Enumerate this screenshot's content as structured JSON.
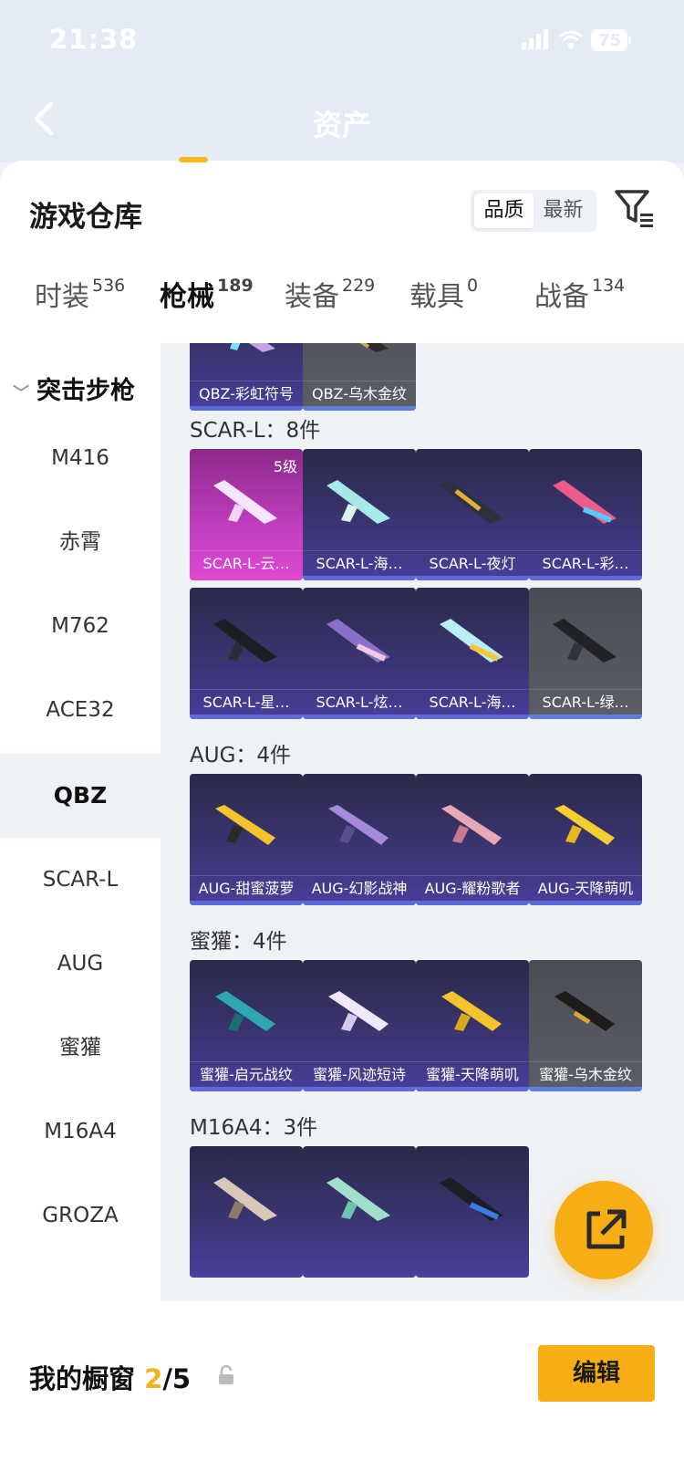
{
  "status": {
    "time": "21:38",
    "battery": "75"
  },
  "nav": {
    "title": "资产"
  },
  "sheet": {
    "title": "游戏仓库",
    "sort_options": [
      "品质",
      "最新"
    ]
  },
  "tabs": [
    {
      "label": "时装",
      "count": "536"
    },
    {
      "label": "枪械",
      "count": "189"
    },
    {
      "label": "装备",
      "count": "229"
    },
    {
      "label": "载具",
      "count": "0"
    },
    {
      "label": "战备",
      "count": "134"
    }
  ],
  "sidebar": {
    "category": "突击步枪",
    "items": [
      "M416",
      "赤霄",
      "M762",
      "ACE32",
      "QBZ",
      "SCAR-L",
      "AUG",
      "蜜獾",
      "M16A4",
      "GROZA"
    ]
  },
  "sections": [
    {
      "title": "",
      "items": [
        {
          "name": "QBZ-彩虹符号"
        },
        {
          "name": "QBZ-乌木金纹"
        }
      ]
    },
    {
      "title": "SCAR-L：8件",
      "items": [
        {
          "name": "SCAR-L-云…",
          "level": "5级"
        },
        {
          "name": "SCAR-L-海…"
        },
        {
          "name": "SCAR-L-夜灯"
        },
        {
          "name": "SCAR-L-彩…"
        },
        {
          "name": "SCAR-L-星…"
        },
        {
          "name": "SCAR-L-炫…"
        },
        {
          "name": "SCAR-L-海…"
        },
        {
          "name": "SCAR-L-绿…"
        }
      ]
    },
    {
      "title": "AUG：4件",
      "items": [
        {
          "name": "AUG-甜蜜菠萝"
        },
        {
          "name": "AUG-幻影战神"
        },
        {
          "name": "AUG-耀粉歌者"
        },
        {
          "name": "AUG-天降萌叽"
        }
      ]
    },
    {
      "title": "蜜獾：4件",
      "items": [
        {
          "name": "蜜獾-启元战纹"
        },
        {
          "name": "蜜獾-风迹短诗"
        },
        {
          "name": "蜜獾-天降萌叽"
        },
        {
          "name": "蜜獾-乌木金纹"
        }
      ]
    },
    {
      "title": "M16A4：3件",
      "items": [
        {
          "name": ""
        },
        {
          "name": ""
        },
        {
          "name": ""
        }
      ]
    }
  ],
  "bottom": {
    "label": "我的橱窗",
    "count": "2",
    "total": "/5",
    "edit": "编辑"
  },
  "colors": {
    "accent": "#f6ae14",
    "purple_card": "#3a3470",
    "gray_card": "#5b5e67",
    "pink_card": "#c03ec0"
  },
  "icons": {
    "back": "chevron-left-icon",
    "filter": "filter-icon",
    "lock": "lock-icon",
    "share": "external-link-icon"
  }
}
